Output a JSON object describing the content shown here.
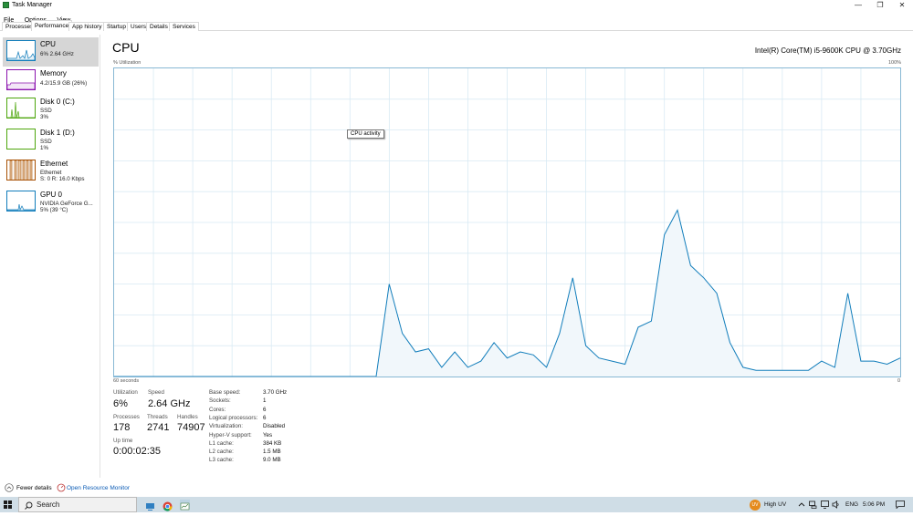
{
  "window": {
    "title": "Task Manager"
  },
  "controls": {
    "minimize": "—",
    "maximize": "❐",
    "close": "✕"
  },
  "menu": [
    "File",
    "Options",
    "View"
  ],
  "tabs": [
    "Processes",
    "Performance",
    "App history",
    "Startup",
    "Users",
    "Details",
    "Services"
  ],
  "sidebar": [
    {
      "name": "CPU",
      "line1": "6% 2.64 GHz",
      "line2": "",
      "color": "#117dbb"
    },
    {
      "name": "Memory",
      "line1": "4.2/15.9 GB (26%)",
      "line2": "",
      "color": "#8b12ae"
    },
    {
      "name": "Disk 0 (C:)",
      "line1": "SSD",
      "line2": "3%",
      "color": "#4da60c"
    },
    {
      "name": "Disk 1 (D:)",
      "line1": "SSD",
      "line2": "1%",
      "color": "#4da60c"
    },
    {
      "name": "Ethernet",
      "line1": "Ethernet",
      "line2": "S: 0 R: 16.0 Kbps",
      "color": "#a74f01"
    },
    {
      "name": "GPU 0",
      "line1": "NVIDIA GeForce G...",
      "line2": "5% (39 °C)",
      "color": "#117dbb"
    }
  ],
  "main": {
    "title": "CPU",
    "cpu_name": "Intel(R) Core(TM) i5-9600K CPU @ 3.70GHz",
    "graph_label": "% Utilization",
    "graph_max": "100%",
    "graph_time": "60 seconds",
    "graph_min": "0",
    "tooltip": "CPU activity"
  },
  "chart_data": {
    "type": "area",
    "ylim": [
      0,
      100
    ],
    "x": [
      60,
      59,
      58,
      57,
      56,
      55,
      54,
      53,
      52,
      51,
      50,
      49,
      48,
      47,
      46,
      45,
      44,
      43,
      42,
      41,
      40,
      39,
      38,
      37,
      36,
      35,
      34,
      33,
      32,
      31,
      30,
      29,
      28,
      27,
      26,
      25,
      24,
      23,
      22,
      21,
      20,
      19,
      18,
      17,
      16,
      15,
      14,
      13,
      12,
      11,
      10,
      9,
      8,
      7,
      6,
      5,
      4,
      3,
      2,
      1,
      0
    ],
    "values": [
      0,
      0,
      0,
      0,
      0,
      0,
      0,
      0,
      0,
      0,
      0,
      0,
      0,
      0,
      0,
      0,
      0,
      0,
      0,
      0,
      0,
      30,
      14,
      8,
      9,
      3,
      8,
      3,
      5,
      11,
      6,
      8,
      7,
      3,
      14,
      32,
      10,
      6,
      5,
      4,
      16,
      18,
      46,
      54,
      36,
      32,
      27,
      11,
      3,
      2,
      2,
      2,
      2,
      2,
      5,
      3,
      27,
      5,
      5,
      4,
      6
    ]
  },
  "stats": {
    "utilization_label": "Utilization",
    "utilization": "6%",
    "speed_label": "Speed",
    "speed": "2.64 GHz",
    "processes_label": "Processes",
    "processes": "178",
    "threads_label": "Threads",
    "threads": "2741",
    "handles_label": "Handles",
    "handles": "74907",
    "uptime_label": "Up time",
    "uptime": "0:00:02:35"
  },
  "specs": [
    {
      "label": "Base speed:",
      "value": "3.70 GHz"
    },
    {
      "label": "Sockets:",
      "value": "1"
    },
    {
      "label": "Cores:",
      "value": "6"
    },
    {
      "label": "Logical processors:",
      "value": "6"
    },
    {
      "label": "Virtualization:",
      "value": "Disabled"
    },
    {
      "label": "Hyper-V support:",
      "value": "Yes"
    },
    {
      "label": "L1 cache:",
      "value": "384 KB"
    },
    {
      "label": "L2 cache:",
      "value": "1.5 MB"
    },
    {
      "label": "L3 cache:",
      "value": "9.0 MB"
    }
  ],
  "footer": {
    "fewer_details": "Fewer details",
    "resource_monitor": "Open Resource Monitor"
  },
  "taskbar": {
    "search": "Search",
    "weather": "High UV",
    "weather_badge": "UV",
    "lang": "ENG",
    "time": "5:06 PM"
  }
}
